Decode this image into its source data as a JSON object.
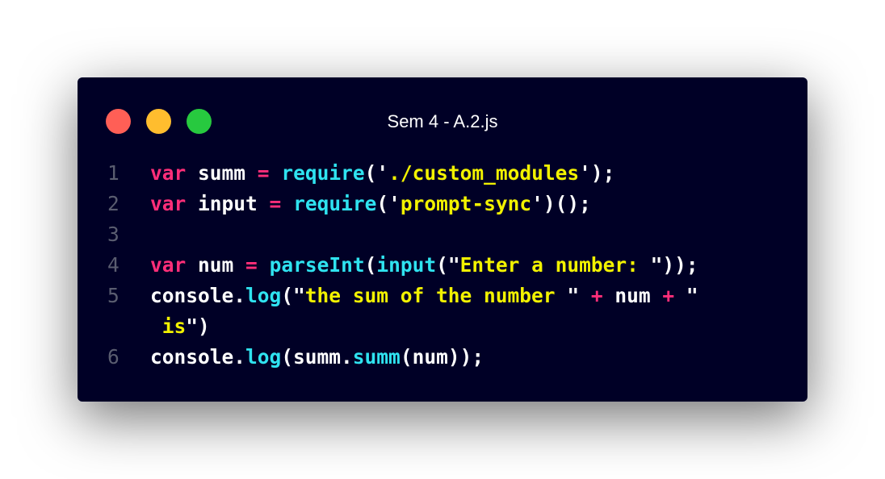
{
  "window": {
    "title": "Sem 4 - A.2.js",
    "colors": {
      "background": "#000026",
      "traffic_red": "#ff5f56",
      "traffic_yellow": "#ffbd2e",
      "traffic_green": "#27c93f",
      "keyword": "#ff2e79",
      "function": "#2fe3f0",
      "string": "#f2f200",
      "line_number": "#5a5d70"
    }
  },
  "code": {
    "lines": [
      {
        "number": "1",
        "tokens": [
          {
            "text": "var",
            "type": "kw"
          },
          {
            "text": " summ ",
            "type": "pl"
          },
          {
            "text": "=",
            "type": "op"
          },
          {
            "text": " ",
            "type": "pl"
          },
          {
            "text": "require",
            "type": "fn"
          },
          {
            "text": "('",
            "type": "pl"
          },
          {
            "text": "./custom_modules",
            "type": "str"
          },
          {
            "text": "');",
            "type": "pl"
          }
        ]
      },
      {
        "number": "2",
        "tokens": [
          {
            "text": "var",
            "type": "kw"
          },
          {
            "text": " input ",
            "type": "pl"
          },
          {
            "text": "=",
            "type": "op"
          },
          {
            "text": " ",
            "type": "pl"
          },
          {
            "text": "require",
            "type": "fn"
          },
          {
            "text": "('",
            "type": "pl"
          },
          {
            "text": "prompt-sync",
            "type": "str"
          },
          {
            "text": "')();",
            "type": "pl"
          }
        ]
      },
      {
        "number": "3",
        "tokens": []
      },
      {
        "number": "4",
        "tokens": [
          {
            "text": "var",
            "type": "kw"
          },
          {
            "text": " num ",
            "type": "pl"
          },
          {
            "text": "=",
            "type": "op"
          },
          {
            "text": " ",
            "type": "pl"
          },
          {
            "text": "parseInt",
            "type": "fn"
          },
          {
            "text": "(",
            "type": "pl"
          },
          {
            "text": "input",
            "type": "fn"
          },
          {
            "text": "(\"",
            "type": "pl"
          },
          {
            "text": "Enter a number: ",
            "type": "str"
          },
          {
            "text": "\"));",
            "type": "pl"
          }
        ]
      },
      {
        "number": "5",
        "tokens": [
          {
            "text": "console.",
            "type": "pl"
          },
          {
            "text": "log",
            "type": "fn"
          },
          {
            "text": "(\"",
            "type": "pl"
          },
          {
            "text": "the sum of the number ",
            "type": "str"
          },
          {
            "text": "\" ",
            "type": "pl"
          },
          {
            "text": "+",
            "type": "op"
          },
          {
            "text": " num ",
            "type": "pl"
          },
          {
            "text": "+",
            "type": "op"
          },
          {
            "text": " \"",
            "type": "pl"
          }
        ]
      },
      {
        "number": "",
        "tokens": [
          {
            "text": " ",
            "type": "pl"
          },
          {
            "text": "is",
            "type": "str"
          },
          {
            "text": "\")",
            "type": "pl"
          }
        ]
      },
      {
        "number": "6",
        "tokens": [
          {
            "text": "console.",
            "type": "pl"
          },
          {
            "text": "log",
            "type": "fn"
          },
          {
            "text": "(summ.",
            "type": "pl"
          },
          {
            "text": "summ",
            "type": "fn"
          },
          {
            "text": "(num));",
            "type": "pl"
          }
        ]
      }
    ]
  }
}
